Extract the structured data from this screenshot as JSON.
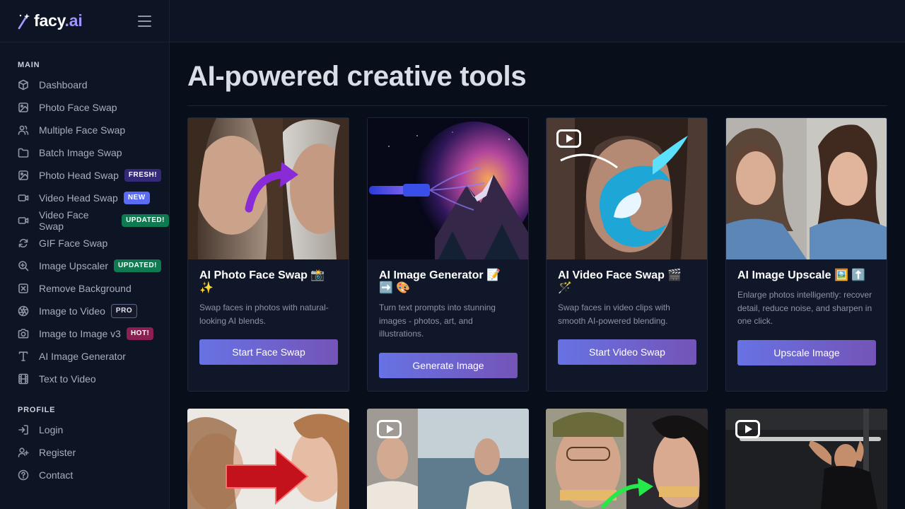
{
  "brand": {
    "name": "facy",
    "tld": ".ai"
  },
  "sidebar": {
    "sections": [
      {
        "heading": "MAIN",
        "items": [
          {
            "label": "Dashboard",
            "icon": "cube-icon",
            "badge": null
          },
          {
            "label": "Photo Face Swap",
            "icon": "image-icon",
            "badge": null
          },
          {
            "label": "Multiple Face Swap",
            "icon": "users-icon",
            "badge": null
          },
          {
            "label": "Batch Image Swap",
            "icon": "folder-icon",
            "badge": null
          },
          {
            "label": "Photo Head Swap",
            "icon": "image-icon",
            "badge": "FRESH!"
          },
          {
            "label": "Video Head Swap",
            "icon": "video-icon",
            "badge": "NEW"
          },
          {
            "label": "Video Face Swap",
            "icon": "video-icon",
            "badge": "UPDATED!"
          },
          {
            "label": "GIF Face Swap",
            "icon": "refresh-icon",
            "badge": null
          },
          {
            "label": "Image Upscaler",
            "icon": "zoom-in-icon",
            "badge": "UPDATED!"
          },
          {
            "label": "Remove Background",
            "icon": "x-square-icon",
            "badge": null
          },
          {
            "label": "Image to Video",
            "icon": "aperture-icon",
            "badge": "PRO"
          },
          {
            "label": "Image to Image v3",
            "icon": "camera-icon",
            "badge": "HOT!"
          },
          {
            "label": "AI Image Generator",
            "icon": "type-icon",
            "badge": null
          },
          {
            "label": "Text to Video",
            "icon": "film-icon",
            "badge": null
          }
        ]
      },
      {
        "heading": "PROFILE",
        "items": [
          {
            "label": "Login",
            "icon": "log-in-icon",
            "badge": null
          },
          {
            "label": "Register",
            "icon": "user-plus-icon",
            "badge": null
          },
          {
            "label": "Contact",
            "icon": "help-circle-icon",
            "badge": null
          }
        ]
      }
    ]
  },
  "main": {
    "title": "AI-powered creative tools",
    "cards": [
      {
        "title": "AI Photo Face Swap 📸 ✨",
        "description": "Swap faces in photos with natural-looking AI blends.",
        "button": "Start Face Swap"
      },
      {
        "title": "AI Image Generator 📝 ➡️ 🎨",
        "description": "Turn text prompts into stunning images - photos, art, and illustrations.",
        "button": "Generate Image"
      },
      {
        "title": "AI Video Face Swap 🎬 🪄",
        "description": "Swap faces in video clips with smooth AI-powered blending.",
        "button": "Start Video Swap"
      },
      {
        "title": "AI Image Upscale 🖼️ ⬆️",
        "description": "Enlarge photos intelligently: recover detail, reduce noise, and sharpen in one click.",
        "button": "Upscale Image"
      }
    ]
  },
  "colors": {
    "background": "#090e1b",
    "sidebar": "#0d1424",
    "accent_start": "#6772e4",
    "accent_end": "#7454b7",
    "brand_tld": "#9f93ff"
  }
}
